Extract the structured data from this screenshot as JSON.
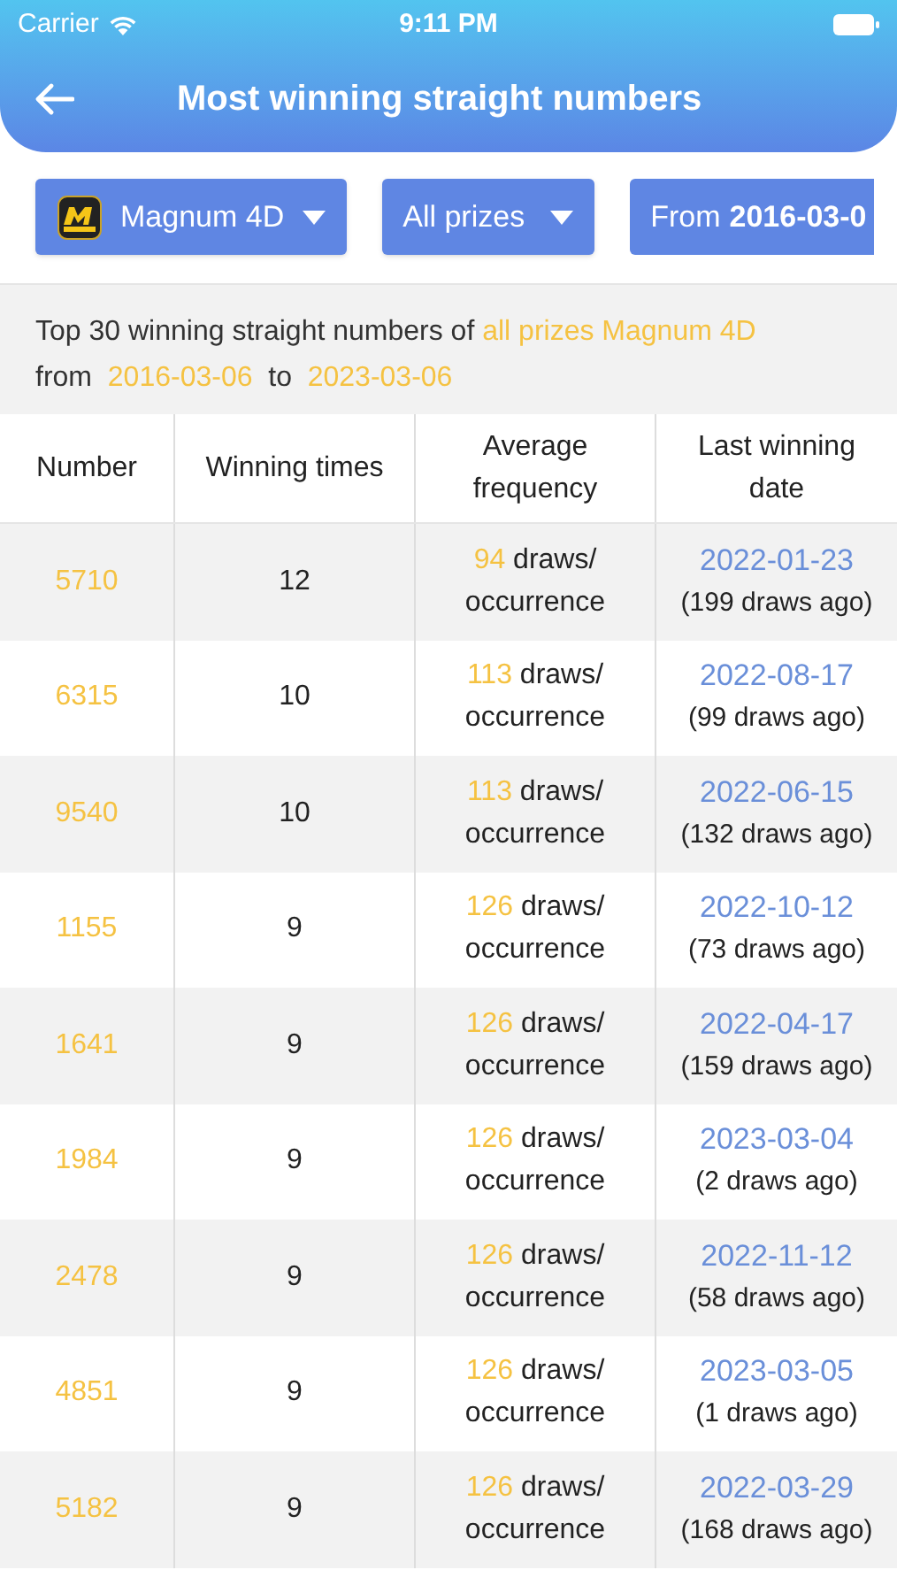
{
  "status_bar": {
    "carrier": "Carrier",
    "time": "9:11 PM"
  },
  "header": {
    "title": "Most winning straight numbers"
  },
  "filters": [
    {
      "kind": "game",
      "label": "Magnum 4D"
    },
    {
      "kind": "dropdown",
      "label": "All prizes"
    },
    {
      "kind": "date",
      "prefix": "From",
      "label": "2016-03-0"
    }
  ],
  "summary": [
    [
      {
        "text": "Top 30 winning straight numbers of",
        "highlight": false
      },
      {
        "text": "all prizes Magnum 4D",
        "highlight": true
      }
    ],
    [
      {
        "text": "from",
        "highlight": false
      },
      {
        "text": "2016-03-06",
        "highlight": true
      },
      {
        "text": "to",
        "highlight": false
      },
      {
        "text": "2023-03-06",
        "highlight": true
      }
    ]
  ],
  "table": {
    "columns": [
      "Number",
      "Winning times",
      "Average frequency",
      "Last winning date"
    ],
    "rows": [
      {
        "number": "5710",
        "times": "12",
        "frequency": "94",
        "unit": "draws/ occurrence",
        "date": "2022-01-23",
        "ago": "(199 draws ago)"
      },
      {
        "number": "6315",
        "times": "10",
        "frequency": "113",
        "unit": "draws/ occurrence",
        "date": "2022-08-17",
        "ago": "(99 draws ago)"
      },
      {
        "number": "9540",
        "times": "10",
        "frequency": "113",
        "unit": "draws/ occurrence",
        "date": "2022-06-15",
        "ago": "(132 draws ago)"
      },
      {
        "number": "1155",
        "times": "9",
        "frequency": "126",
        "unit": "draws/ occurrence",
        "date": "2022-10-12",
        "ago": "(73 draws ago)"
      },
      {
        "number": "1641",
        "times": "9",
        "frequency": "126",
        "unit": "draws/ occurrence",
        "date": "2022-04-17",
        "ago": "(159 draws ago)"
      },
      {
        "number": "1984",
        "times": "9",
        "frequency": "126",
        "unit": "draws/ occurrence",
        "date": "2023-03-04",
        "ago": "(2 draws ago)"
      },
      {
        "number": "2478",
        "times": "9",
        "frequency": "126",
        "unit": "draws/ occurrence",
        "date": "2022-11-12",
        "ago": "(58 draws ago)"
      },
      {
        "number": "4851",
        "times": "9",
        "frequency": "126",
        "unit": "draws/ occurrence",
        "date": "2023-03-05",
        "ago": "(1 draws ago)"
      },
      {
        "number": "5182",
        "times": "9",
        "frequency": "126",
        "unit": "draws/ occurrence",
        "date": "2022-03-29",
        "ago": "(168 draws ago)"
      }
    ]
  }
}
